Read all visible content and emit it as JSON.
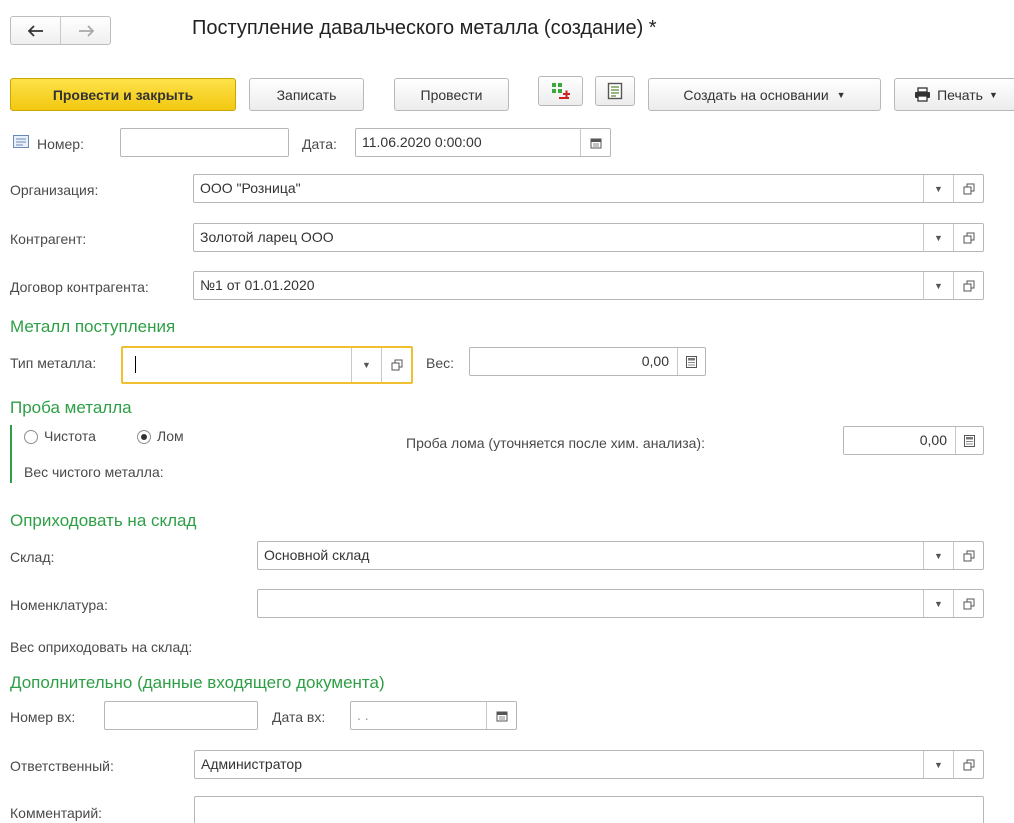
{
  "nav": {
    "back_icon": "arrow-left-icon",
    "forward_icon": "arrow-right-icon"
  },
  "window": {
    "title": "Поступление давальческого металла (создание) *"
  },
  "toolbar": {
    "post_close_label": "Провести и закрыть",
    "save_label": "Записать",
    "post_label": "Провести",
    "movements_icon": "register-movements-icon",
    "report_icon": "report-icon",
    "create_based_label": "Создать на основании",
    "print_label": "Печать",
    "print_icon": "printer-icon"
  },
  "header": {
    "number_label": "Номер:",
    "number_value": "",
    "date_label": "Дата:",
    "date_value": "11.06.2020  0:00:00"
  },
  "main": {
    "organization_label": "Организация:",
    "organization_value": "ООО \"Розница\"",
    "counterparty_label": "Контрагент:",
    "counterparty_value": "Золотой ларец ООО",
    "contract_label": "Договор контрагента:",
    "contract_value": "№1 от 01.01.2020"
  },
  "metal": {
    "section_title": "Металл поступления",
    "type_label": "Тип металла:",
    "type_value": "",
    "weight_label": "Вес:",
    "weight_value": "0,00"
  },
  "assay": {
    "section_title": "Проба металла",
    "purity_label": "Чистота",
    "scrap_label": "Лом",
    "selected": "Лом",
    "scrap_assay_label": "Проба лома (уточняется после хим. анализа):",
    "scrap_assay_value": "0,00",
    "pure_weight_label": "Вес чистого металла:"
  },
  "warehouse": {
    "section_title": "Оприходовать на склад",
    "warehouse_label": "Склад:",
    "warehouse_value": "Основной склад",
    "item_label": "Номенклатура:",
    "item_value": "",
    "weight_label": "Вес оприходовать на склад:"
  },
  "extra": {
    "section_title": "Дополнительно (данные входящего документа)",
    "in_number_label": "Номер вх:",
    "in_number_value": "",
    "in_date_label": "Дата вх:",
    "in_date_value": " .  .",
    "responsible_label": "Ответственный:",
    "responsible_value": "Администратор",
    "comment_label": "Комментарий:",
    "comment_value": ""
  },
  "colors": {
    "accent_yellow": "#f2c811",
    "section_green": "#2e9f46",
    "focus_border": "#f0c030"
  }
}
